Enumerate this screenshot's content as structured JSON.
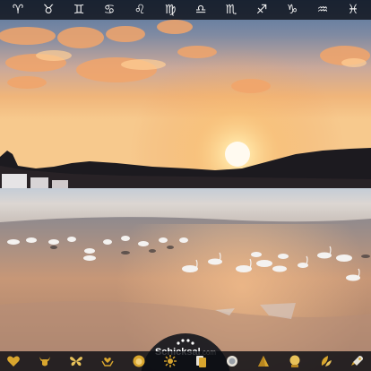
{
  "zodiac_bar": {
    "signs": [
      {
        "glyph": "♈︎",
        "name": "aries-icon"
      },
      {
        "glyph": "♉︎",
        "name": "taurus-icon"
      },
      {
        "glyph": "♊︎",
        "name": "gemini-icon"
      },
      {
        "glyph": "♋︎",
        "name": "cancer-icon"
      },
      {
        "glyph": "♌︎",
        "name": "leo-icon"
      },
      {
        "glyph": "♍︎",
        "name": "virgo-icon"
      },
      {
        "glyph": "♎︎",
        "name": "libra-icon"
      },
      {
        "glyph": "♏︎",
        "name": "scorpio-icon"
      },
      {
        "glyph": "♐︎",
        "name": "sagittarius-icon"
      },
      {
        "glyph": "♑︎",
        "name": "capricorn-icon"
      },
      {
        "glyph": "♒︎",
        "name": "aquarius-icon"
      },
      {
        "glyph": "♓︎",
        "name": "pisces-icon"
      }
    ]
  },
  "brand": {
    "name": "Schicksal",
    "suffix": ".com"
  },
  "bottom_bar": {
    "icons": [
      "heart-icon",
      "taurus-head-icon",
      "butterfly-icon",
      "heart-hands-icon",
      "leo-head-icon",
      "sun-flower-icon",
      "cards-icon",
      "coin-icon",
      "pyramid-icon",
      "crystal-ball-icon",
      "leaves-icon",
      "rocket-icon"
    ]
  },
  "colors": {
    "gold": "#d9a62e",
    "bar": "#0a0c12",
    "sun": "#fff1c2"
  }
}
